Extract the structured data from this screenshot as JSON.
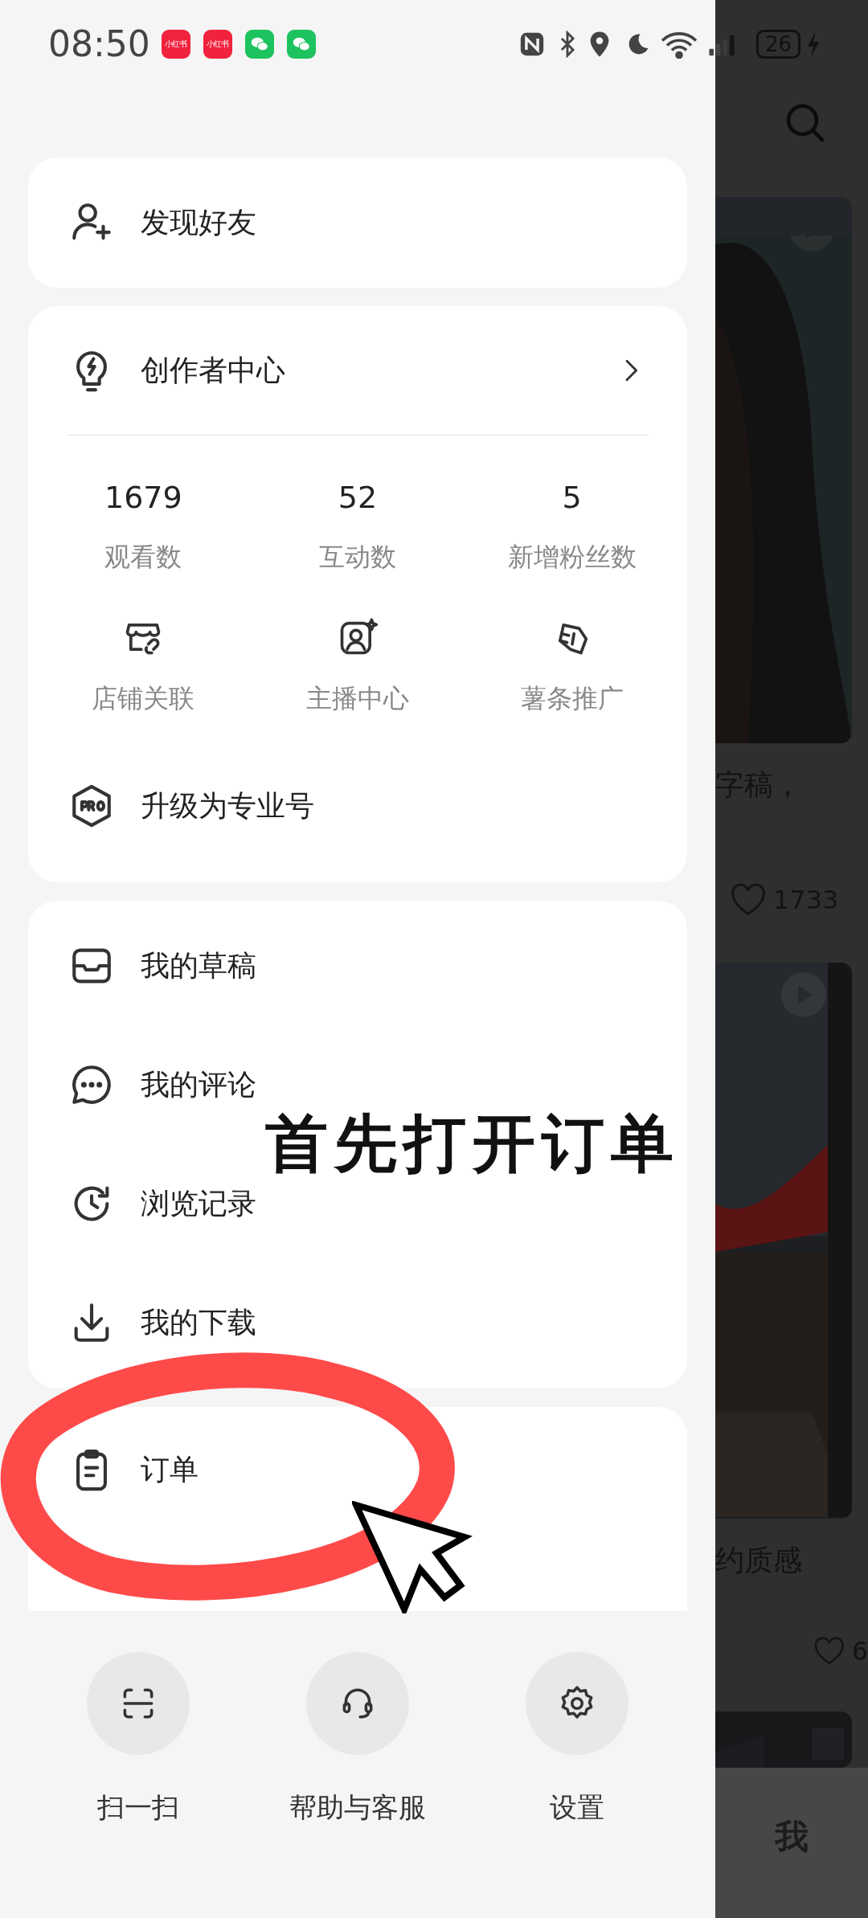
{
  "status_bar": {
    "time": "08:50",
    "notifications": [
      {
        "kind": "xhs",
        "label": "小红书"
      },
      {
        "kind": "xhs",
        "label": "小红书"
      },
      {
        "kind": "wechat"
      },
      {
        "kind": "wechat"
      }
    ],
    "battery": "26"
  },
  "find_friends": {
    "label": "发现好友"
  },
  "creator_center": {
    "title": "创作者中心",
    "stats": [
      {
        "value": "1679",
        "label": "观看数"
      },
      {
        "value": "52",
        "label": "互动数"
      },
      {
        "value": "5",
        "label": "新增粉丝数"
      }
    ],
    "tools": [
      {
        "label": "店铺关联"
      },
      {
        "label": "主播中心"
      },
      {
        "label": "薯条推广"
      }
    ],
    "upgrade": {
      "label": "升级为专业号"
    }
  },
  "menu": [
    {
      "label": "我的草稿"
    },
    {
      "label": "我的评论"
    },
    {
      "label": "浏览记录"
    },
    {
      "label": "我的下载"
    }
  ],
  "orders": [
    {
      "label": "订单"
    }
  ],
  "bottom_actions": [
    {
      "label": "扫一扫"
    },
    {
      "label": "帮助与客服"
    },
    {
      "label": "设置"
    }
  ],
  "feed": {
    "cards": [
      {
        "kind": "note",
        "title": "字稿，",
        "likes": "1733"
      },
      {
        "kind": "note",
        "title": "约质感",
        "likes": "6"
      },
      {
        "kind": "picture"
      }
    ],
    "tab": "我"
  },
  "annotation": {
    "text": "首先打开订单"
  }
}
